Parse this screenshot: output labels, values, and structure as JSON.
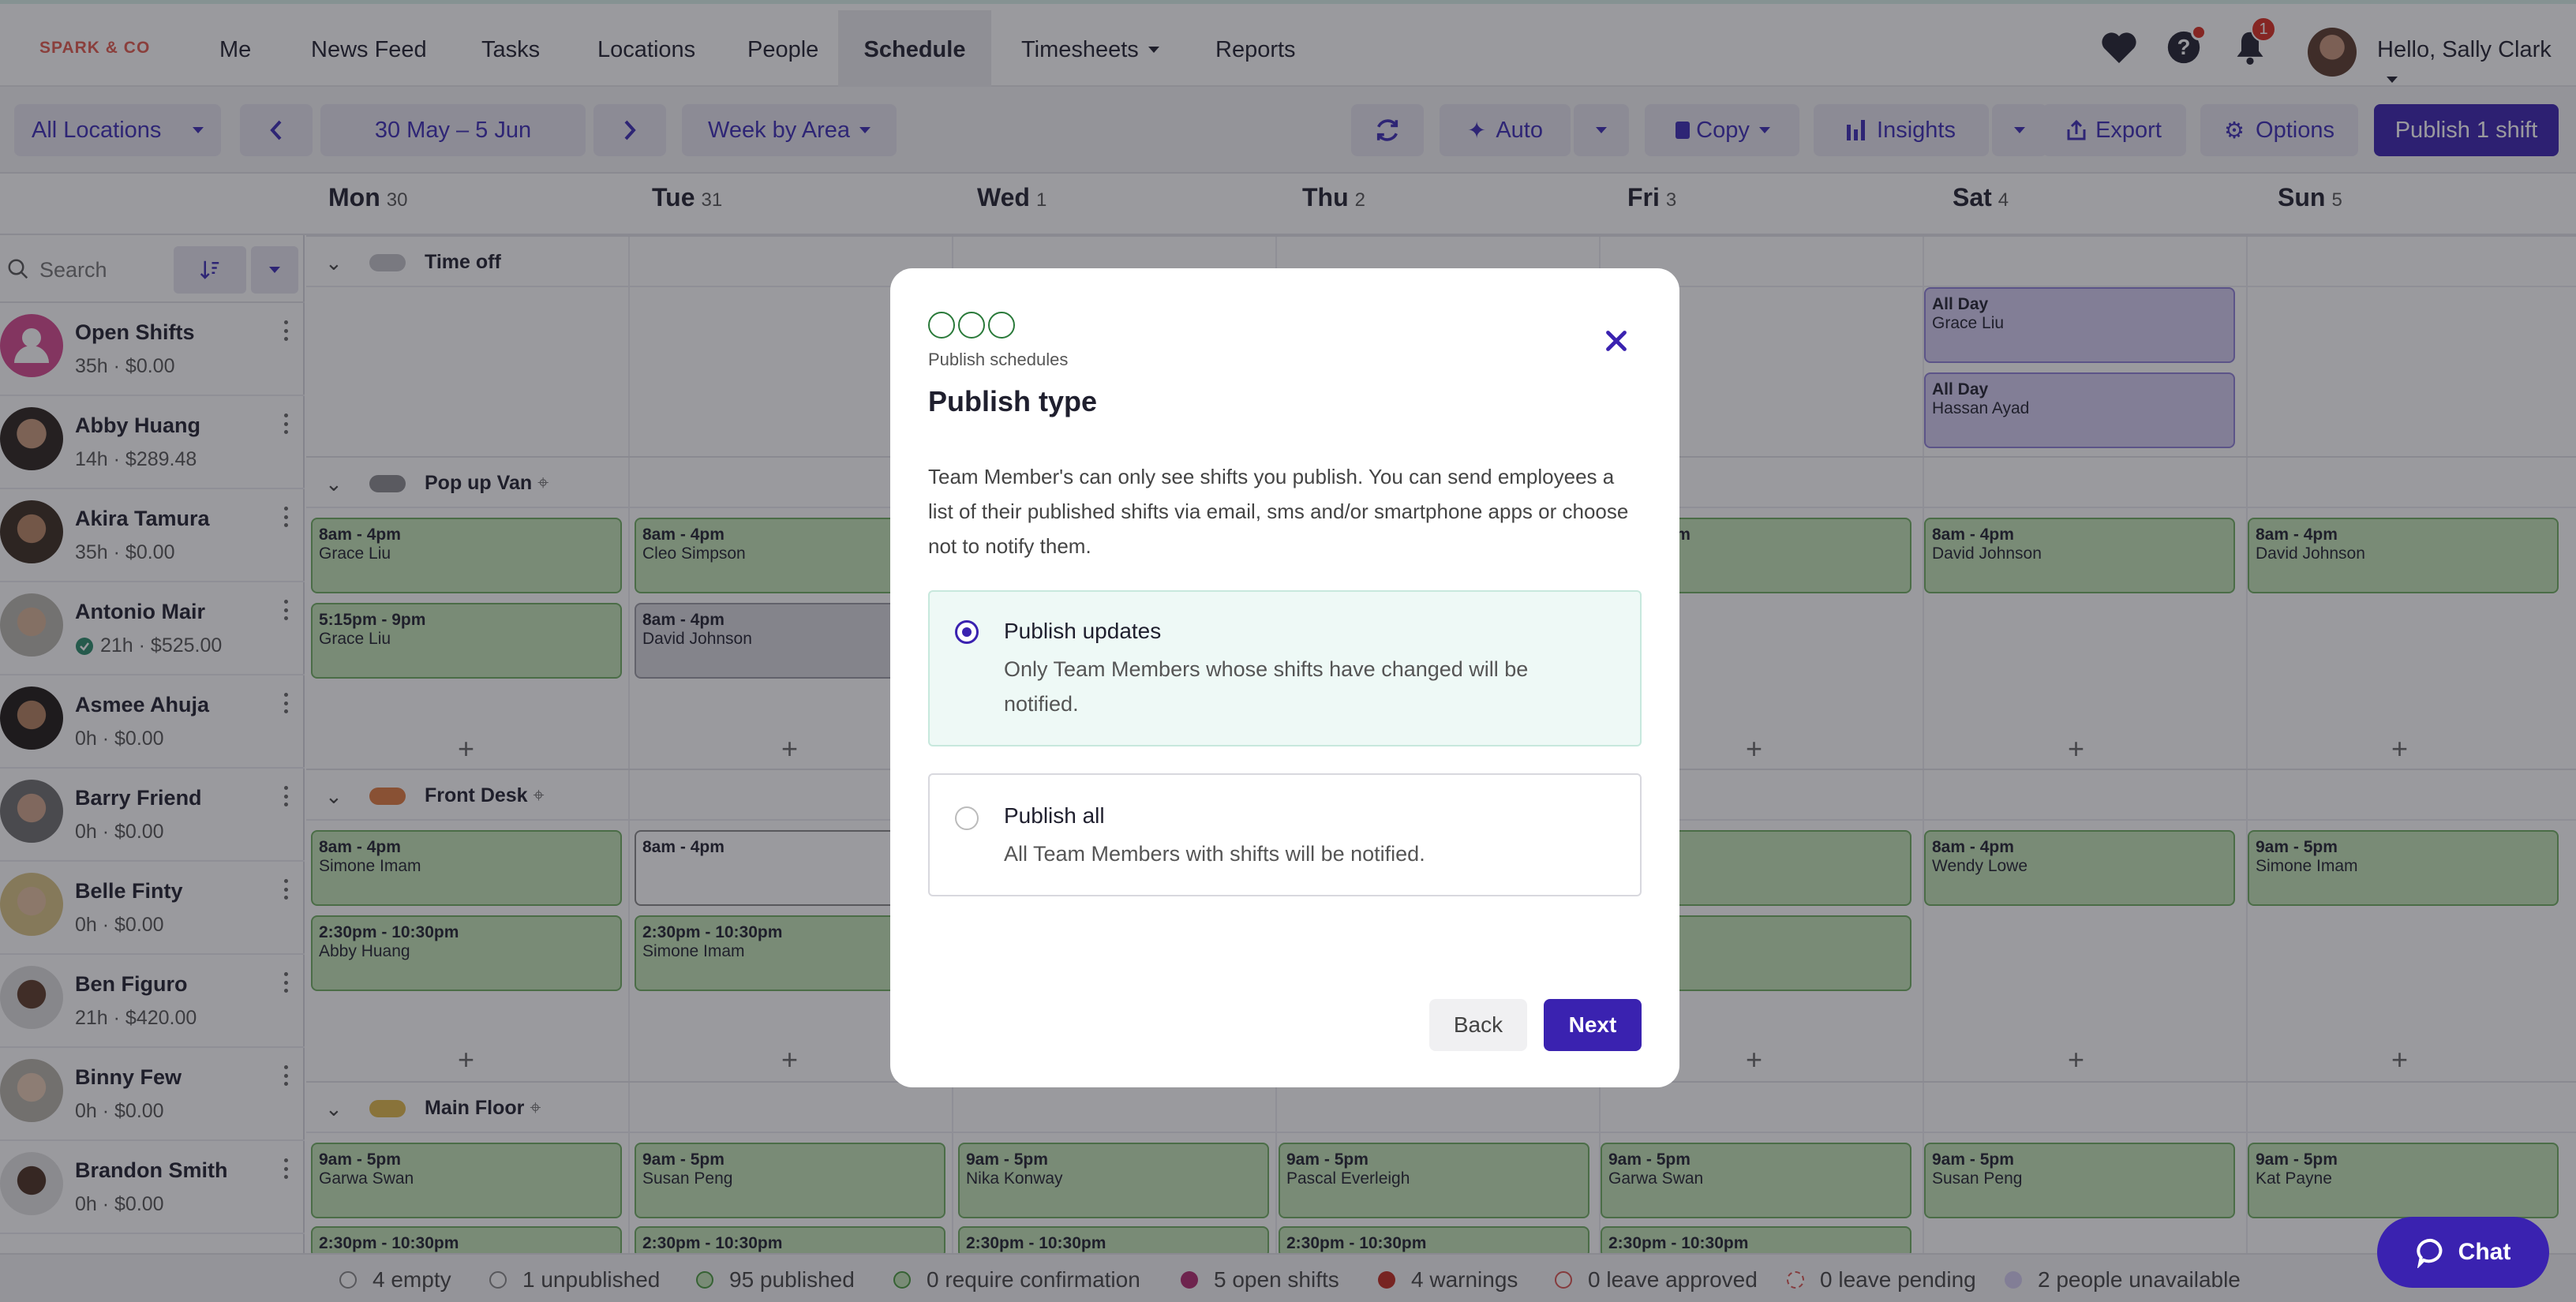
{
  "brand": "SPARK & CO",
  "nav": {
    "items": [
      {
        "label": "Me"
      },
      {
        "label": "News Feed"
      },
      {
        "label": "Tasks"
      },
      {
        "label": "Locations"
      },
      {
        "label": "People"
      },
      {
        "label": "Schedule",
        "active": true
      },
      {
        "label": "Timesheets",
        "dropdown": true
      },
      {
        "label": "Reports"
      }
    ],
    "notifications_count": "1",
    "greeting": "Hello, Sally Clark"
  },
  "toolbar": {
    "location_select": "All Locations",
    "date_range": "30 May – 5 Jun",
    "view_select": "Week by Area",
    "auto_label": "Auto",
    "copy_label": "Copy",
    "insights_label": "Insights",
    "export_label": "Export",
    "options_label": "Options",
    "publish_label": "Publish 1 shift"
  },
  "days": [
    {
      "name": "Mon",
      "num": "30"
    },
    {
      "name": "Tue",
      "num": "31"
    },
    {
      "name": "Wed",
      "num": "1"
    },
    {
      "name": "Thu",
      "num": "2"
    },
    {
      "name": "Fri",
      "num": "3"
    },
    {
      "name": "Sat",
      "num": "4"
    },
    {
      "name": "Sun",
      "num": "5"
    }
  ],
  "sidebar": {
    "search_placeholder": "Search",
    "staff": [
      {
        "name": "Open Shifts",
        "meta": "35h · $0.00"
      },
      {
        "name": "Abby Huang",
        "meta": "14h · $289.48"
      },
      {
        "name": "Akira Tamura",
        "meta": "35h · $0.00"
      },
      {
        "name": "Antonio Mair",
        "meta": "21h · $525.00",
        "verified": true
      },
      {
        "name": "Asmee Ahuja",
        "meta": "0h · $0.00"
      },
      {
        "name": "Barry Friend",
        "meta": "0h · $0.00"
      },
      {
        "name": "Belle Finty",
        "meta": "0h · $0.00"
      },
      {
        "name": "Ben Figuro",
        "meta": "21h · $420.00"
      },
      {
        "name": "Binny Few",
        "meta": "0h · $0.00"
      },
      {
        "name": "Brandon Smith",
        "meta": "0h · $0.00"
      }
    ]
  },
  "groups": [
    {
      "title": "Time off",
      "color": "#c4c4c8"
    },
    {
      "title": "Pop up Van",
      "color": "#8a8a8e"
    },
    {
      "title": "Front Desk",
      "color": "#e07a3f"
    },
    {
      "title": "Main Floor",
      "color": "#e0b84a"
    }
  ],
  "shifts": {
    "timeoff": [
      {
        "time": "All Day",
        "who": "Grace Liu"
      },
      {
        "time": "All Day",
        "who": "Hassan Ayad"
      }
    ],
    "popup": [
      {
        "time": "8am - 4pm",
        "who": "Grace Liu"
      },
      {
        "time": "5:15pm - 9pm",
        "who": "Grace Liu"
      },
      {
        "time": "8am - 4pm",
        "who": "Cleo Simpson"
      },
      {
        "time": "8am - 4pm",
        "who": "David Johnson"
      },
      {
        "time": "8am - 4pm",
        "who": "nson"
      },
      {
        "time": "8am - 4pm",
        "who": "David Johnson"
      },
      {
        "time": "8am - 4pm",
        "who": "David Johnson"
      }
    ],
    "frontdesk": [
      {
        "time": "8am - 4pm",
        "who": "Simone Imam"
      },
      {
        "time": "2:30pm - 10:30pm",
        "who": "Abby Huang"
      },
      {
        "time": "8am - 4pm",
        "who": ""
      },
      {
        "time": "2:30pm - 10:30pm",
        "who": "Simone Imam"
      },
      {
        "time": "",
        "who": "nam"
      },
      {
        "time": "10:30pm",
        "who": "owe"
      },
      {
        "time": "8am - 4pm",
        "who": "Wendy Lowe"
      },
      {
        "time": "9am - 5pm",
        "who": "Simone Imam"
      }
    ],
    "mainfloor": [
      {
        "time": "9am - 5pm",
        "who": "Garwa Swan"
      },
      {
        "time": "9am - 5pm",
        "who": "Susan Peng"
      },
      {
        "time": "9am - 5pm",
        "who": "Nika Konway"
      },
      {
        "time": "9am - 5pm",
        "who": "Pascal Everleigh"
      },
      {
        "time": "9am - 5pm",
        "who": "Garwa Swan"
      },
      {
        "time": "9am - 5pm",
        "who": "Susan Peng"
      },
      {
        "time": "9am - 5pm",
        "who": "Kat Payne"
      },
      {
        "time": "2:30pm - 10:30pm",
        "who": ""
      }
    ]
  },
  "status": [
    {
      "label": "4 empty",
      "color": "#ffffff",
      "ring": "#888"
    },
    {
      "label": "1 unpublished",
      "color": "#ffffff",
      "ring": "#888"
    },
    {
      "label": "95 published",
      "color": "#c4e4b7",
      "ring": "#4a9a3f"
    },
    {
      "label": "0 require confirmation",
      "color": "#c4e4b7",
      "ring": "#4a9a3f"
    },
    {
      "label": "5 open shifts",
      "color": "#b0286e",
      "ring": "#b0286e"
    },
    {
      "label": "4 warnings",
      "color": "#c0281e",
      "ring": "#c0281e"
    },
    {
      "label": "0 leave approved",
      "color": "#ffffff",
      "ring": "#d9534f"
    },
    {
      "label": "0 leave pending",
      "color": "#ffffff",
      "ring": "#d9534f"
    },
    {
      "label": "2 people unavailable",
      "color": "#d4cdf0",
      "ring": "#d4cdf0"
    }
  ],
  "chat_label": "Chat",
  "modal": {
    "eyebrow": "Publish schedules",
    "title": "Publish type",
    "description": "Team Member's can only see shifts you publish. You can send employees a list of their published shifts via email, sms and/or smartphone apps or choose not to notify them.",
    "options": [
      {
        "title": "Publish updates",
        "desc": "Only Team Members whose shifts have changed will be notified.",
        "selected": true
      },
      {
        "title": "Publish all",
        "desc": "All Team Members with shifts will be notified.",
        "selected": false
      }
    ],
    "back_label": "Back",
    "next_label": "Next"
  },
  "colors": {
    "accent": "#3a22b0",
    "brand": "#e25a4d",
    "published": "#c4e4b7"
  }
}
